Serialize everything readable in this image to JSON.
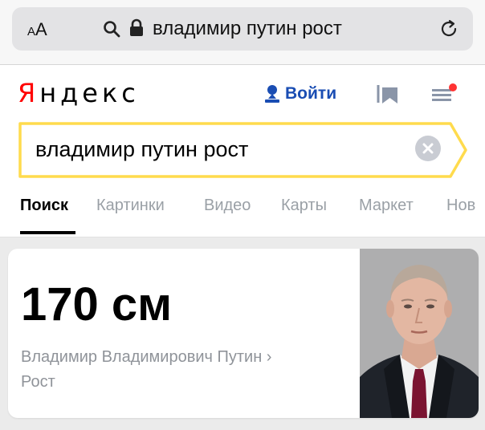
{
  "browser": {
    "text_size_label_small": "A",
    "text_size_label_large": "A",
    "url_text": "владимир путин рост",
    "icons": [
      "search-icon",
      "lock-icon",
      "reload-icon"
    ]
  },
  "header": {
    "logo_first": "Я",
    "logo_rest": "ндекс",
    "login_label": "Войти",
    "icons": [
      "user-icon",
      "collections-icon",
      "menu-icon"
    ]
  },
  "search": {
    "query": "владимир путин рост",
    "accent_color": "#ffdb4d"
  },
  "tabs": [
    {
      "label": "Поиск",
      "active": true
    },
    {
      "label": "Картинки",
      "active": false
    },
    {
      "label": "Видео",
      "active": false
    },
    {
      "label": "Карты",
      "active": false
    },
    {
      "label": "Маркет",
      "active": false
    },
    {
      "label": "Нов",
      "active": false
    }
  ],
  "answer_card": {
    "value": "170 см",
    "source_line_1": "Владимир Владимирович Путин ›",
    "source_line_2": "Рост"
  },
  "colors": {
    "logo_red": "#ff0000",
    "login_blue": "#1a4db3",
    "notification_dot": "#ff3333"
  }
}
